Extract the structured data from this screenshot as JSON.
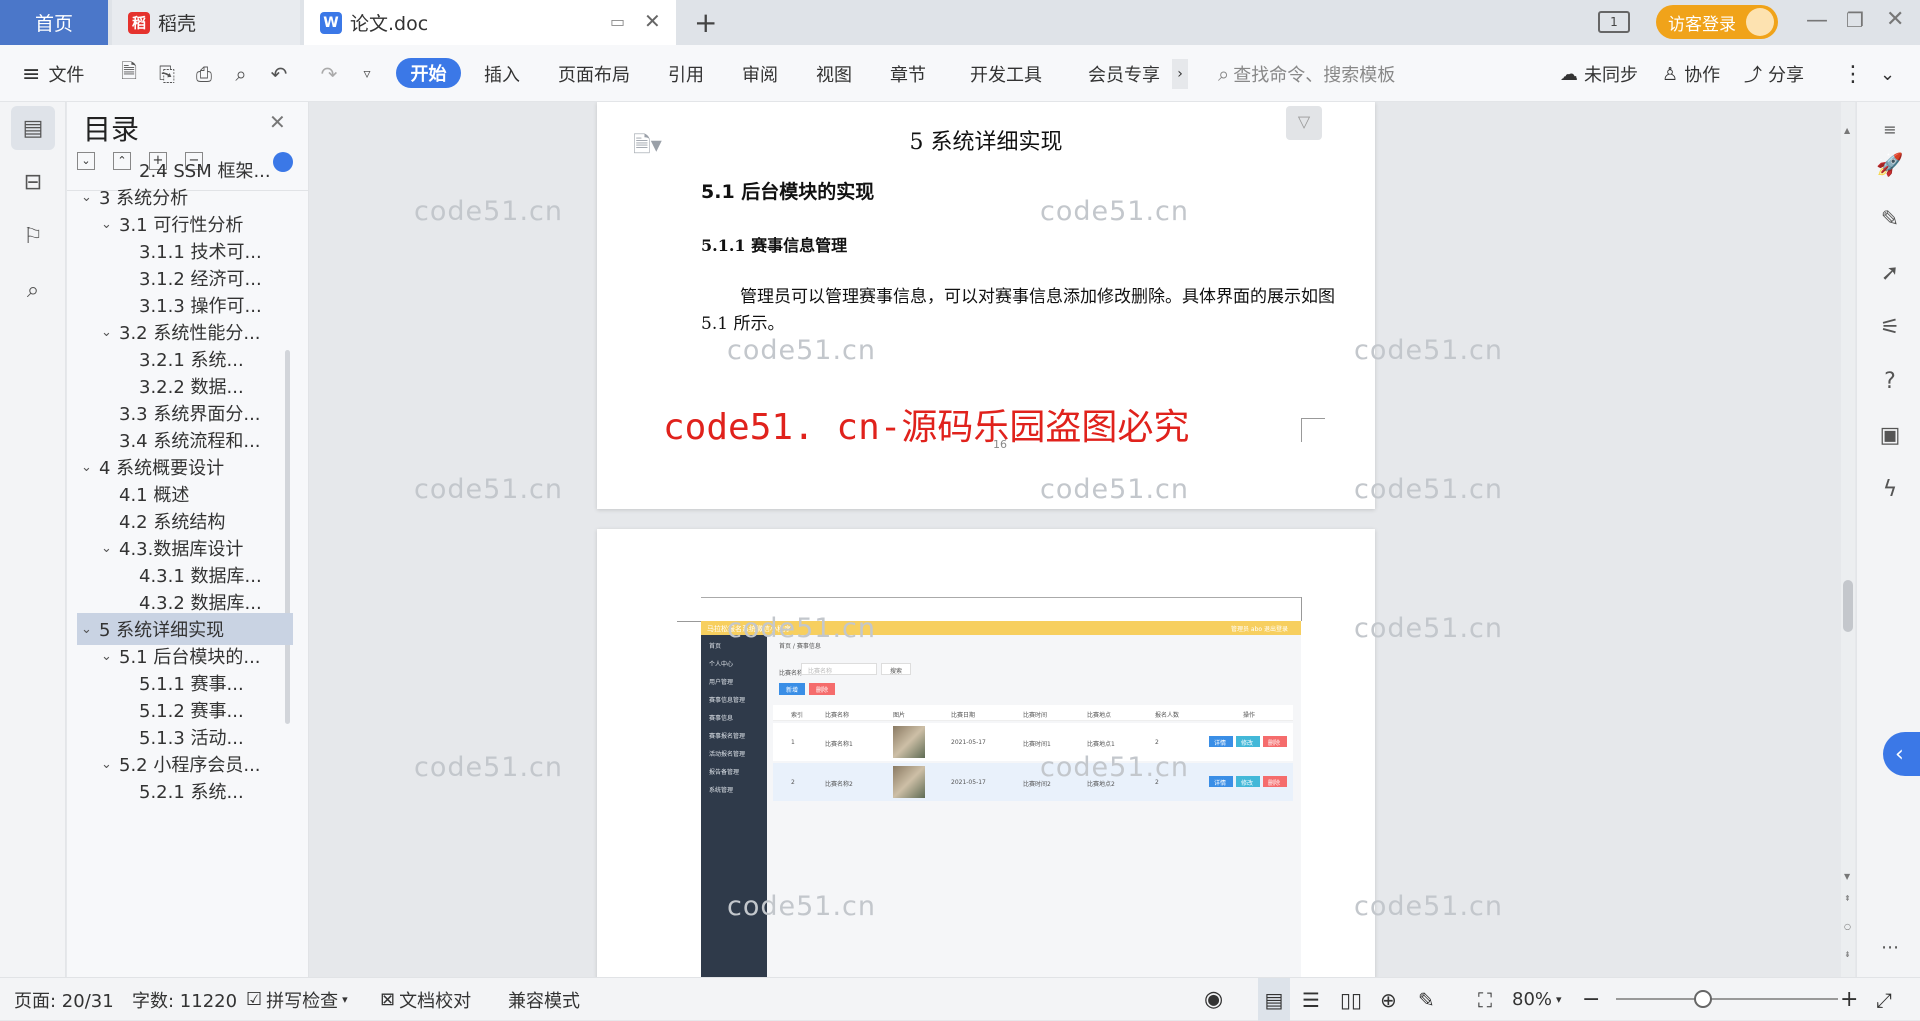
{
  "tabs": {
    "home": "首页",
    "daoke": "稻壳",
    "doc": "论文.doc",
    "visitor_login": "访客登录"
  },
  "toolbar": {
    "file": "文件",
    "start": "开始",
    "insert": "插入",
    "layout": "页面布局",
    "reference": "引用",
    "review": "审阅",
    "view": "视图",
    "chapter": "章节",
    "devtools": "开发工具",
    "vip": "会员专享",
    "search_placeholder": "查找命令、搜索模板",
    "sync": "未同步",
    "collab": "协作",
    "share": "分享"
  },
  "toc": {
    "title": "目录",
    "items": [
      {
        "label": "2.4 SSM 框架..."
      },
      {
        "label": "3 系统分析"
      },
      {
        "label": "3.1 可行性分析"
      },
      {
        "label": "3.1.1 技术可..."
      },
      {
        "label": "3.1.2 经济可..."
      },
      {
        "label": "3.1.3 操作可..."
      },
      {
        "label": "3.2 系统性能分..."
      },
      {
        "label": "3.2.1  系统..."
      },
      {
        "label": "3.2.2  数据..."
      },
      {
        "label": "3.3 系统界面分..."
      },
      {
        "label": "3.4 系统流程和..."
      },
      {
        "label": "4 系统概要设计"
      },
      {
        "label": "4.1 概述"
      },
      {
        "label": "4.2 系统结构"
      },
      {
        "label": "4.3.数据库设计"
      },
      {
        "label": "4.3.1 数据库..."
      },
      {
        "label": "4.3.2 数据库..."
      },
      {
        "label": "5 系统详细实现"
      },
      {
        "label": "5.1  后台模块的..."
      },
      {
        "label": "5.1.1  赛事..."
      },
      {
        "label": "5.1.2  赛事..."
      },
      {
        "label": "5.1.3  活动..."
      },
      {
        "label": "5.2  小程序会员..."
      },
      {
        "label": "5.2.1  系统..."
      }
    ]
  },
  "document": {
    "chapter_title": "5 系统详细实现",
    "section_title": "5.1  后台模块的实现",
    "subsection_title": "5.1.1   赛事信息管理",
    "para_line1": "管理员可以管理赛事信息，可以对赛事信息添加修改删除。具体界面的展示如图",
    "para_line2": "5.1 所示。",
    "page_number": "16",
    "red_watermark": "code51. cn-源码乐园盗图必究",
    "watermark": "code51.cn"
  },
  "screenshot_mock": {
    "app_title": "马拉松报名系统微信小程序",
    "header_right": "管理员 abo    退出登录",
    "breadcrumb": "首页 / 赛事信息",
    "search_label": "比赛名称",
    "search_placeholder": "比赛名称",
    "search_button": "搜索",
    "add_button": "新增",
    "delete_button": "删除",
    "menu": [
      "首页",
      "个人中心",
      "用户管理",
      "赛事信息管理",
      "赛事信息",
      "赛事报名管理",
      "活动报名管理",
      "报告备管理",
      "系统管理"
    ],
    "columns": [
      "索引",
      "比赛名称",
      "图片",
      "比赛日期",
      "比赛时间",
      "比赛地点",
      "报名人数",
      "操作"
    ],
    "rows": [
      {
        "idx": "1",
        "name": "比赛名称1",
        "date": "2021-05-17",
        "time": "比赛时间1",
        "place": "比赛地点1",
        "count": "2"
      },
      {
        "idx": "2",
        "name": "比赛名称2",
        "date": "2021-05-17",
        "time": "比赛时间2",
        "place": "比赛地点2",
        "count": "2"
      }
    ],
    "action_labels": [
      "详情",
      "修改",
      "删除"
    ]
  },
  "status": {
    "page": "页面: 20/31",
    "words": "字数: 11220",
    "spell": "拼写检查",
    "proof": "文档校对",
    "compat": "兼容模式",
    "zoom": "80%"
  },
  "colors": {
    "accent": "#3b78e7",
    "home_tab": "#4b77c9",
    "login_pill": "#f0a31a",
    "red_watermark": "#e0221c",
    "toc_selected": "#c9d3e3",
    "mock_header": "#f7cf5f",
    "mock_sidebar": "#2f3a4a"
  }
}
